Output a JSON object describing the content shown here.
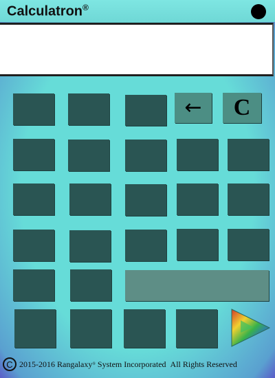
{
  "app": {
    "title": "Calculatron",
    "title_mark": "®"
  },
  "display": {
    "value": ""
  },
  "keys": {
    "backspace": "←",
    "clear": "C"
  },
  "footer": {
    "copyright_symbol": "C",
    "years": "2015-2016",
    "company": "Rangalaxy",
    "company_mark": "®",
    "company_rest": "System Incorporated",
    "rights": "All Rights Reserved"
  },
  "colors": {
    "frame": "#66dcd8",
    "key": "#2a5553",
    "key_light": "#4c8e84",
    "display": "#ffffff"
  },
  "icons": {
    "close": "black-circle-icon",
    "play": "play-triangle-icon"
  }
}
